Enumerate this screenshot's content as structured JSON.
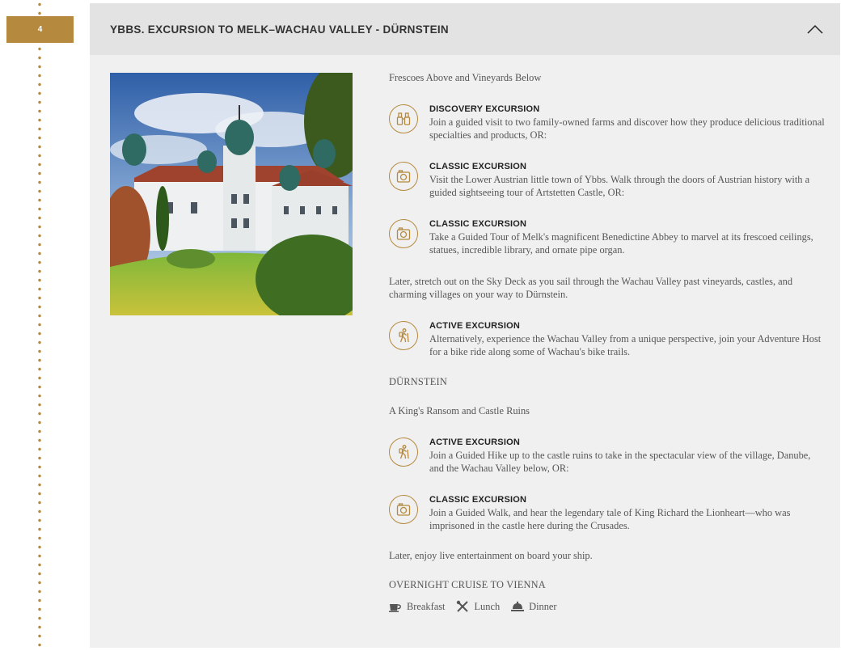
{
  "day": {
    "number": "4"
  },
  "header": {
    "title": "YBBS. EXCURSION TO MELK–WACHAU VALLEY - DÜRNSTEIN"
  },
  "content": {
    "intro": "Frescoes Above and Vineyards Below",
    "excursions_a": [
      {
        "icon": "binoculars-icon",
        "title": "DISCOVERY EXCURSION",
        "desc": "Join a guided visit to two family-owned farms and discover how they produce delicious traditional specialties and products, OR:"
      },
      {
        "icon": "camera-icon",
        "title": "CLASSIC EXCURSION",
        "desc": "Visit the Lower Austrian little town of Ybbs. Walk through the doors of Austrian history with a guided sightseeing tour of Artstetten Castle, OR:"
      },
      {
        "icon": "camera-icon",
        "title": "CLASSIC EXCURSION",
        "desc": "Take a Guided Tour of Melk's magnificent Benedictine Abbey to marvel at its frescoed ceilings, statues, incredible library, and ornate pipe organ."
      }
    ],
    "later1": "Later, stretch out on the Sky Deck as you sail through the Wachau Valley past vineyards, castles, and charming villages on your way to Dürnstein.",
    "excursion_b": {
      "icon": "hiker-icon",
      "title": "ACTIVE EXCURSION",
      "desc": "Alternatively, experience the Wachau Valley from a unique perspective, join your Adventure Host for a bike ride along some of Wachau's bike trails."
    },
    "city": "DÜRNSTEIN",
    "subtitle": "A King's Ransom and Castle Ruins",
    "excursions_c": [
      {
        "icon": "hiker-icon",
        "title": "ACTIVE EXCURSION",
        "desc": "Join a Guided Hike up to the castle ruins to take in the spectacular view of the village, Danube, and the Wachau Valley below, OR:"
      },
      {
        "icon": "camera-icon",
        "title": "CLASSIC EXCURSION",
        "desc": "Join a Guided Walk, and hear the legendary tale of King Richard the Lionheart—who was imprisoned in the castle here during the Crusades."
      }
    ],
    "later2": "Later, enjoy live entertainment on board your ship.",
    "overnight": "OVERNIGHT CRUISE TO VIENNA",
    "meals": {
      "breakfast": "Breakfast",
      "lunch": "Lunch",
      "dinner": "Dinner"
    }
  },
  "colors": {
    "accent": "#b58a3e",
    "panel": "#f0f0f0",
    "header": "#e3e3e3"
  }
}
